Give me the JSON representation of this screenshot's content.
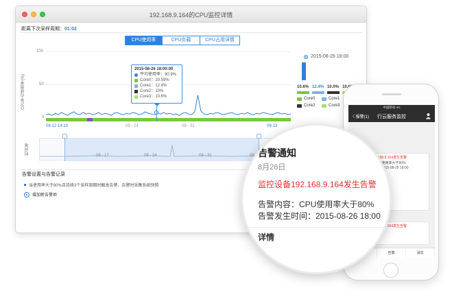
{
  "window": {
    "title": "192.168.9.164的CPU监控详情",
    "countdown_label": "距离下次采样周期：",
    "countdown_value": "01:02"
  },
  "tabs": [
    {
      "label": "CPU使用率",
      "active": true
    },
    {
      "label": "CPU负载",
      "active": false
    },
    {
      "label": "CPU占用详情",
      "active": false
    }
  ],
  "chart_data": {
    "type": "line",
    "ylabel": "CPU平均使用率(%)",
    "ylim": [
      0,
      100
    ],
    "y_ticks": [
      "100",
      "50",
      "0"
    ],
    "x_ticks": [
      "08-12 14:10",
      "08 - 24",
      "08 - 31",
      "09-13"
    ],
    "series": [
      {
        "name": "平均使用率",
        "color": "#2f82dc",
        "values": [
          13,
          14,
          12,
          15,
          13,
          16,
          14,
          12,
          15,
          17,
          14,
          13,
          16,
          14,
          15,
          13,
          14,
          16,
          13,
          15,
          14,
          12,
          15,
          16,
          14,
          13,
          15,
          14,
          16,
          15,
          13,
          14,
          17,
          15,
          14,
          13,
          15,
          14,
          16,
          14,
          15,
          13,
          14,
          12,
          15,
          16,
          14,
          13,
          17,
          40,
          18,
          14,
          13,
          15,
          14,
          16,
          15,
          13,
          14,
          15,
          16,
          14,
          13,
          15,
          14,
          16,
          14,
          13,
          15,
          14,
          16,
          15,
          14,
          13,
          15,
          16,
          14,
          15,
          13,
          14
        ]
      }
    ],
    "tooltip": {
      "time": "2015-08-26 18:00:00",
      "rows": [
        {
          "label": "平均使用率：90.9%",
          "color": "#2f82dc"
        },
        {
          "label": "Core0：10.59%",
          "color": "#78c83b"
        },
        {
          "label": "Core1：12.4%",
          "color": "#7fb2e8"
        },
        {
          "label": "Core2：10%",
          "color": "#333333"
        },
        {
          "label": "Core3：10.6%",
          "color": "#a6e07a"
        }
      ]
    }
  },
  "side_panel": {
    "date": "2015-08-26 18:00",
    "percents": [
      "10.6%",
      "12.4%",
      "10.0%",
      "10.6%"
    ],
    "cores": [
      {
        "label": "Core0",
        "color": "#78c83b"
      },
      {
        "label": "Core1",
        "color": "#7fb2e8"
      },
      {
        "label": "Core2",
        "color": "#333333"
      },
      {
        "label": "Core3",
        "color": "#a6e07a"
      }
    ]
  },
  "navigator": {
    "label": "时间轴",
    "ticks": [
      "08 - 17",
      "08 - 24",
      "08 - 31",
      "09 - 07"
    ]
  },
  "alerts": {
    "section_title": "告警设置与告警记录",
    "rule_text": "当使用率大于80%且持续3个采样周期时触发告警，告警时采集系统快照",
    "add_label": "增加新告警项"
  },
  "phone": {
    "status": "中国移动 4G",
    "back": "〈 报警(1)",
    "nav_title": "行云服务监控",
    "card1_red": "监控设备192.168.9.164发生告警",
    "card1_lines": [
      "告警内容：CPU使用率大于80%",
      "告警发生时间：2015-08-26 18:00"
    ],
    "card2_red": "监控设备192.168.9.164发生告警",
    "footer": [
      "系统",
      "告警",
      "消息"
    ]
  },
  "magnifier": {
    "title": "告警通知",
    "date": "8月26日",
    "red_line": "监控设备192.168.9.164发生告警",
    "content_line": "告警内容：CPU使用率大于80%",
    "time_line": "告警发生时间：2015-08-26 18:00",
    "detail": "详情"
  }
}
